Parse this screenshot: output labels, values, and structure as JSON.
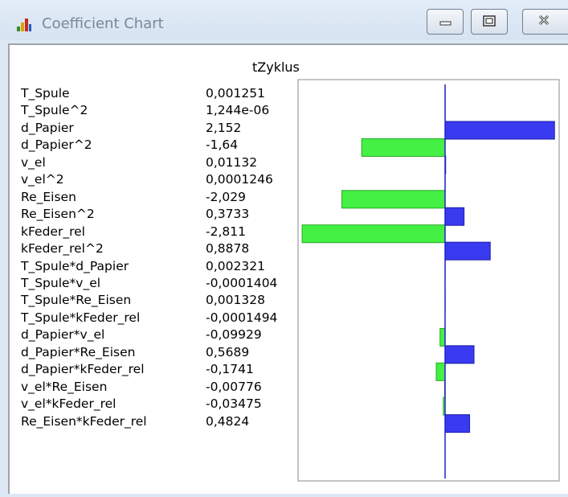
{
  "window": {
    "title": "Coefficient Chart",
    "icon": "bar-chart-icon",
    "buttons": [
      "minimize-icon",
      "restore-icon",
      "close-icon"
    ]
  },
  "chart_data": {
    "type": "bar",
    "orientation": "horizontal",
    "title": "tZyklus",
    "categories": [
      "T_Spule",
      "T_Spule^2",
      "d_Papier",
      "d_Papier^2",
      "v_el",
      "v_el^2",
      "Re_Eisen",
      "Re_Eisen^2",
      "kFeder_rel",
      "kFeder_rel^2",
      "T_Spule*d_Papier",
      "T_Spule*v_el",
      "T_Spule*Re_Eisen",
      "T_Spule*kFeder_rel",
      "d_Papier*v_el",
      "d_Papier*Re_Eisen",
      "d_Papier*kFeder_rel",
      "v_el*Re_Eisen",
      "v_el*kFeder_rel",
      "Re_Eisen*kFeder_rel"
    ],
    "value_labels": [
      "0,001251",
      "1,244e-06",
      "2,152",
      "-1,64",
      "0,01132",
      "0,0001246",
      "-2,029",
      "0,3733",
      "-2,811",
      "0,8878",
      "0,002321",
      "-0,0001404",
      "0,001328",
      "-0,0001494",
      "-0,09929",
      "0,5689",
      "-0,1741",
      "-0,00776",
      "-0,03475",
      "0,4824"
    ],
    "values": [
      0.001251,
      1.244e-06,
      2.152,
      -1.64,
      0.01132,
      0.0001246,
      -2.029,
      0.3733,
      -2.811,
      0.8878,
      0.002321,
      -0.0001404,
      0.001328,
      -0.0001494,
      -0.09929,
      0.5689,
      -0.1741,
      -0.00776,
      -0.03475,
      0.4824
    ],
    "positive_color": "#3a3af0",
    "negative_color": "#44f044",
    "xlim": [
      -2.811,
      2.152
    ],
    "grid": false,
    "legend": "none"
  }
}
